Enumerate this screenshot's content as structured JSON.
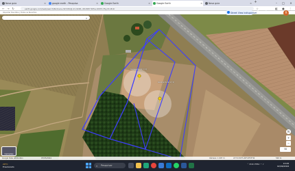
{
  "browser": {
    "tabs": [
      {
        "label": "Nova guia",
        "fav_color": "#5f6368",
        "active": false
      },
      {
        "label": "google earth - Pesquisa",
        "fav_color": "#4285f4",
        "active": false
      },
      {
        "label": "Google Earth",
        "fav_color": "#34a853",
        "active": false
      },
      {
        "label": "Google Earth",
        "fav_color": "#34a853",
        "active": true
      },
      {
        "label": "Nova guia",
        "fav_color": "#5f6368",
        "active": false
      }
    ],
    "url": "earth.google.com/web/search/Rodovia+SP-326/@-21.0248,-48.4987,565a,1097d,35y,0h,0t,0r",
    "bookmarks": "Importar favoritos  |  Todos os favoritos"
  },
  "earth": {
    "search_placeholder": "",
    "streetview_label": "Street View indisponível",
    "avatar_letter": "R",
    "pins": [
      {
        "label": "Garage Rural 1 (1)"
      },
      {
        "label": "Garage Rural 2 (1)"
      }
    ],
    "layers_label": "Camadas",
    "status": {
      "attribution": "Google  Data attribution",
      "date": "07/05/2024",
      "camera": "Câmera: 1 097 m",
      "coords": "21°01'29\"S 48°29'55\"W",
      "elevation": "540 m"
    },
    "controls": {
      "compass": "N",
      "zoom_in": "+",
      "zoom_out": "−",
      "view_3d": "3D"
    }
  },
  "taskbar": {
    "weather_temp": "29°C",
    "weather_desc": "Ensolarado",
    "search_label": "Pesquisar",
    "lang": "POR PTB2",
    "time": "13:05",
    "date": "02/09/2024"
  },
  "colors": {
    "boundary": "#3d3dff",
    "forest": "#1e3a16",
    "crop_field": "#c8a07a",
    "pasture": "#7a8a4a",
    "road": "#9a9a98"
  }
}
